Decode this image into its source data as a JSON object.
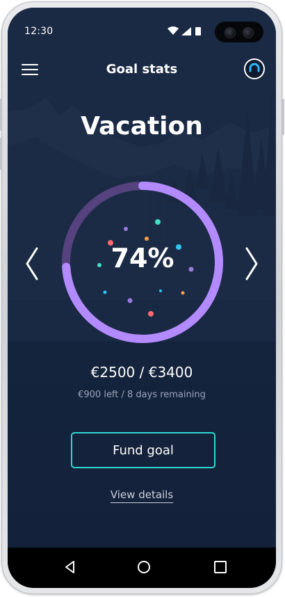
{
  "status_bar": {
    "time": "12:30"
  },
  "header": {
    "title": "Goal stats",
    "menu_icon": "hamburger-menu-icon",
    "account_icon": "account-icon"
  },
  "goal": {
    "name": "Vacation",
    "progress_percent": 74,
    "progress_label": "74%",
    "amounts_text": "€2500 / €3400",
    "remaining_text": "€900 left / 8 days remaining"
  },
  "actions": {
    "fund_label": "Fund goal",
    "details_label": "View details"
  },
  "colors": {
    "progress": "#b38bff",
    "track": "#56427f",
    "button_border": "#2fd6d4",
    "background": "#1a2944"
  },
  "android_nav": {
    "icons": [
      "back-icon",
      "home-icon",
      "recents-icon"
    ]
  }
}
